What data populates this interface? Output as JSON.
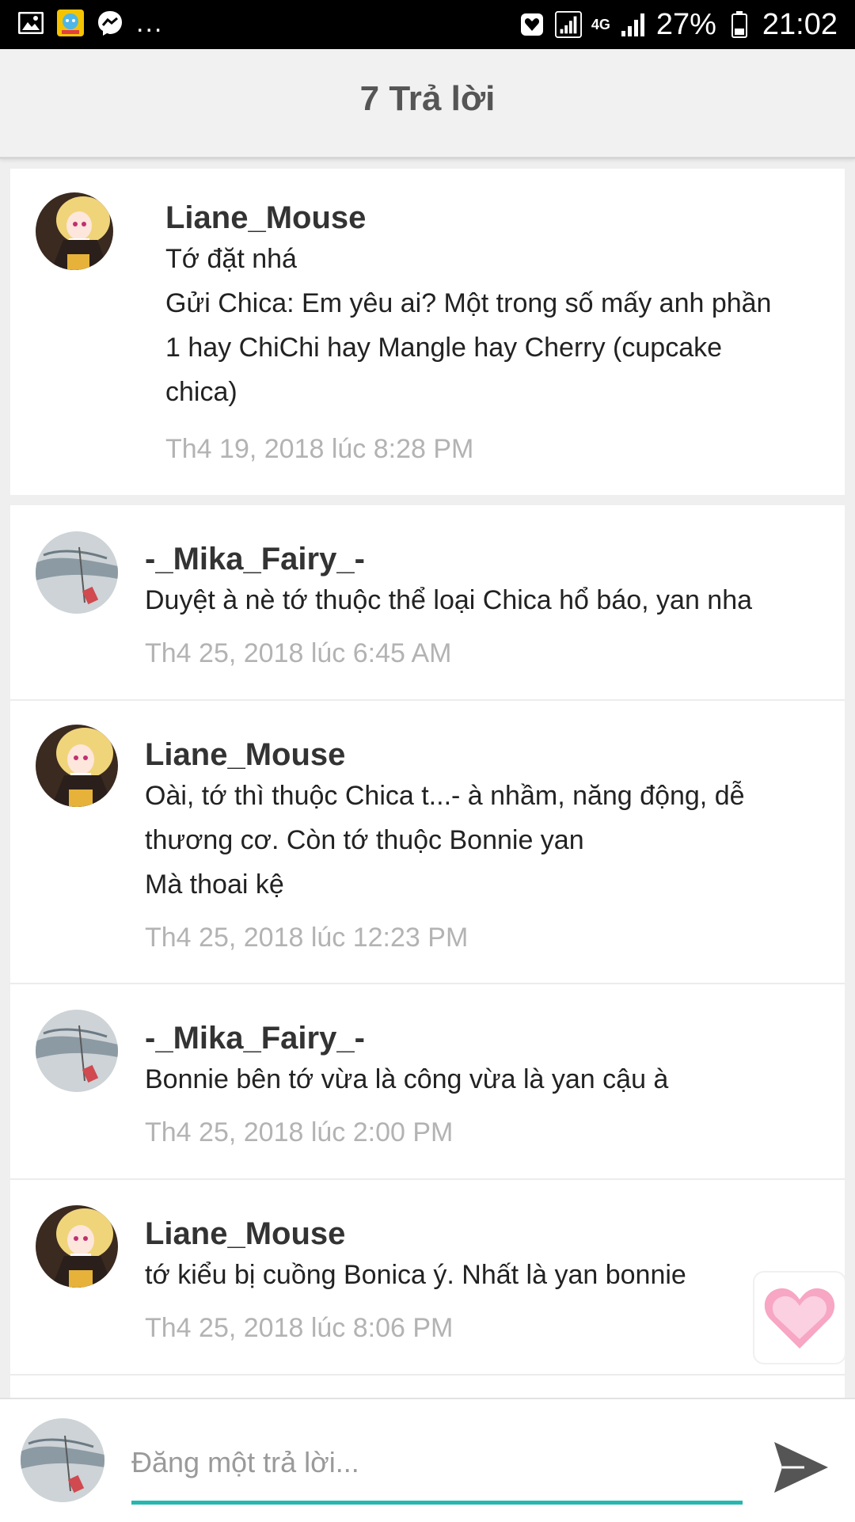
{
  "status_bar": {
    "more": "...",
    "network": "4G",
    "battery_percent": "27%",
    "time": "21:02"
  },
  "header": {
    "title": "7 Trả lời"
  },
  "original_post": {
    "author": "Liane_Mouse",
    "lines": [
      "Tớ đặt nhá",
      "Gửi Chica: Em yêu ai? Một trong số mấy anh phần",
      "1 hay ChiChi hay Mangle hay Cherry (cupcake",
      "chica)"
    ],
    "timestamp": "Th4 19, 2018 lúc 8:28 PM"
  },
  "replies": [
    {
      "author": "-_Mika_Fairy_-",
      "lines": [
        "Duyệt à nè tớ thuộc thể loại Chica hổ báo, yan nha"
      ],
      "timestamp": "Th4 25, 2018 lúc 6:45 AM"
    },
    {
      "author": "Liane_Mouse",
      "lines": [
        "Oài, tớ thì thuộc Chica t...- à nhầm, năng động, dễ",
        "thương cơ. Còn tớ thuộc Bonnie yan",
        "Mà thoai kệ"
      ],
      "timestamp": "Th4 25, 2018 lúc 12:23 PM"
    },
    {
      "author": "-_Mika_Fairy_-",
      "lines": [
        "Bonnie bên tớ vừa là công vừa là yan cậu à"
      ],
      "timestamp": "Th4 25, 2018 lúc 2:00 PM"
    },
    {
      "author": "Liane_Mouse",
      "lines": [
        "tớ kiểu bị cuồng Bonica ý. Nhất là yan bonnie"
      ],
      "timestamp": "Th4 25, 2018 lúc 8:06 PM"
    }
  ],
  "composer": {
    "placeholder": "Đăng một trả lời..."
  },
  "colors": {
    "accent": "#26b8b0",
    "timestamp": "#b3b3b3",
    "heart": "#f7a6c4"
  },
  "icons": {
    "send": "send-icon",
    "heart": "heart-icon",
    "gallery": "gallery-icon",
    "messenger": "messenger-icon"
  }
}
